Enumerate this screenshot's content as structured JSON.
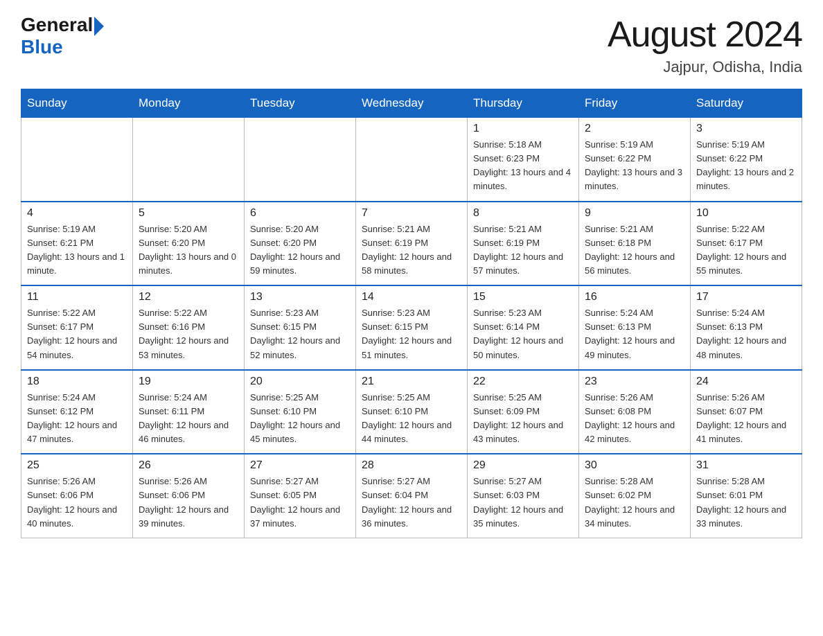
{
  "header": {
    "logo_general": "General",
    "logo_blue": "Blue",
    "month_title": "August 2024",
    "location": "Jajpur, Odisha, India"
  },
  "weekdays": [
    "Sunday",
    "Monday",
    "Tuesday",
    "Wednesday",
    "Thursday",
    "Friday",
    "Saturday"
  ],
  "weeks": [
    [
      {
        "day": "",
        "sunrise": "",
        "sunset": "",
        "daylight": ""
      },
      {
        "day": "",
        "sunrise": "",
        "sunset": "",
        "daylight": ""
      },
      {
        "day": "",
        "sunrise": "",
        "sunset": "",
        "daylight": ""
      },
      {
        "day": "",
        "sunrise": "",
        "sunset": "",
        "daylight": ""
      },
      {
        "day": "1",
        "sunrise": "Sunrise: 5:18 AM",
        "sunset": "Sunset: 6:23 PM",
        "daylight": "Daylight: 13 hours and 4 minutes."
      },
      {
        "day": "2",
        "sunrise": "Sunrise: 5:19 AM",
        "sunset": "Sunset: 6:22 PM",
        "daylight": "Daylight: 13 hours and 3 minutes."
      },
      {
        "day": "3",
        "sunrise": "Sunrise: 5:19 AM",
        "sunset": "Sunset: 6:22 PM",
        "daylight": "Daylight: 13 hours and 2 minutes."
      }
    ],
    [
      {
        "day": "4",
        "sunrise": "Sunrise: 5:19 AM",
        "sunset": "Sunset: 6:21 PM",
        "daylight": "Daylight: 13 hours and 1 minute."
      },
      {
        "day": "5",
        "sunrise": "Sunrise: 5:20 AM",
        "sunset": "Sunset: 6:20 PM",
        "daylight": "Daylight: 13 hours and 0 minutes."
      },
      {
        "day": "6",
        "sunrise": "Sunrise: 5:20 AM",
        "sunset": "Sunset: 6:20 PM",
        "daylight": "Daylight: 12 hours and 59 minutes."
      },
      {
        "day": "7",
        "sunrise": "Sunrise: 5:21 AM",
        "sunset": "Sunset: 6:19 PM",
        "daylight": "Daylight: 12 hours and 58 minutes."
      },
      {
        "day": "8",
        "sunrise": "Sunrise: 5:21 AM",
        "sunset": "Sunset: 6:19 PM",
        "daylight": "Daylight: 12 hours and 57 minutes."
      },
      {
        "day": "9",
        "sunrise": "Sunrise: 5:21 AM",
        "sunset": "Sunset: 6:18 PM",
        "daylight": "Daylight: 12 hours and 56 minutes."
      },
      {
        "day": "10",
        "sunrise": "Sunrise: 5:22 AM",
        "sunset": "Sunset: 6:17 PM",
        "daylight": "Daylight: 12 hours and 55 minutes."
      }
    ],
    [
      {
        "day": "11",
        "sunrise": "Sunrise: 5:22 AM",
        "sunset": "Sunset: 6:17 PM",
        "daylight": "Daylight: 12 hours and 54 minutes."
      },
      {
        "day": "12",
        "sunrise": "Sunrise: 5:22 AM",
        "sunset": "Sunset: 6:16 PM",
        "daylight": "Daylight: 12 hours and 53 minutes."
      },
      {
        "day": "13",
        "sunrise": "Sunrise: 5:23 AM",
        "sunset": "Sunset: 6:15 PM",
        "daylight": "Daylight: 12 hours and 52 minutes."
      },
      {
        "day": "14",
        "sunrise": "Sunrise: 5:23 AM",
        "sunset": "Sunset: 6:15 PM",
        "daylight": "Daylight: 12 hours and 51 minutes."
      },
      {
        "day": "15",
        "sunrise": "Sunrise: 5:23 AM",
        "sunset": "Sunset: 6:14 PM",
        "daylight": "Daylight: 12 hours and 50 minutes."
      },
      {
        "day": "16",
        "sunrise": "Sunrise: 5:24 AM",
        "sunset": "Sunset: 6:13 PM",
        "daylight": "Daylight: 12 hours and 49 minutes."
      },
      {
        "day": "17",
        "sunrise": "Sunrise: 5:24 AM",
        "sunset": "Sunset: 6:13 PM",
        "daylight": "Daylight: 12 hours and 48 minutes."
      }
    ],
    [
      {
        "day": "18",
        "sunrise": "Sunrise: 5:24 AM",
        "sunset": "Sunset: 6:12 PM",
        "daylight": "Daylight: 12 hours and 47 minutes."
      },
      {
        "day": "19",
        "sunrise": "Sunrise: 5:24 AM",
        "sunset": "Sunset: 6:11 PM",
        "daylight": "Daylight: 12 hours and 46 minutes."
      },
      {
        "day": "20",
        "sunrise": "Sunrise: 5:25 AM",
        "sunset": "Sunset: 6:10 PM",
        "daylight": "Daylight: 12 hours and 45 minutes."
      },
      {
        "day": "21",
        "sunrise": "Sunrise: 5:25 AM",
        "sunset": "Sunset: 6:10 PM",
        "daylight": "Daylight: 12 hours and 44 minutes."
      },
      {
        "day": "22",
        "sunrise": "Sunrise: 5:25 AM",
        "sunset": "Sunset: 6:09 PM",
        "daylight": "Daylight: 12 hours and 43 minutes."
      },
      {
        "day": "23",
        "sunrise": "Sunrise: 5:26 AM",
        "sunset": "Sunset: 6:08 PM",
        "daylight": "Daylight: 12 hours and 42 minutes."
      },
      {
        "day": "24",
        "sunrise": "Sunrise: 5:26 AM",
        "sunset": "Sunset: 6:07 PM",
        "daylight": "Daylight: 12 hours and 41 minutes."
      }
    ],
    [
      {
        "day": "25",
        "sunrise": "Sunrise: 5:26 AM",
        "sunset": "Sunset: 6:06 PM",
        "daylight": "Daylight: 12 hours and 40 minutes."
      },
      {
        "day": "26",
        "sunrise": "Sunrise: 5:26 AM",
        "sunset": "Sunset: 6:06 PM",
        "daylight": "Daylight: 12 hours and 39 minutes."
      },
      {
        "day": "27",
        "sunrise": "Sunrise: 5:27 AM",
        "sunset": "Sunset: 6:05 PM",
        "daylight": "Daylight: 12 hours and 37 minutes."
      },
      {
        "day": "28",
        "sunrise": "Sunrise: 5:27 AM",
        "sunset": "Sunset: 6:04 PM",
        "daylight": "Daylight: 12 hours and 36 minutes."
      },
      {
        "day": "29",
        "sunrise": "Sunrise: 5:27 AM",
        "sunset": "Sunset: 6:03 PM",
        "daylight": "Daylight: 12 hours and 35 minutes."
      },
      {
        "day": "30",
        "sunrise": "Sunrise: 5:28 AM",
        "sunset": "Sunset: 6:02 PM",
        "daylight": "Daylight: 12 hours and 34 minutes."
      },
      {
        "day": "31",
        "sunrise": "Sunrise: 5:28 AM",
        "sunset": "Sunset: 6:01 PM",
        "daylight": "Daylight: 12 hours and 33 minutes."
      }
    ]
  ]
}
